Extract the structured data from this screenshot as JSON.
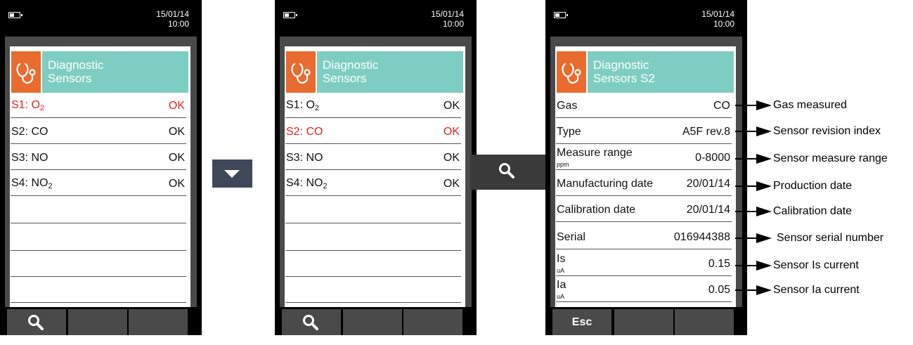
{
  "status": {
    "date": "15/01/14",
    "time": "10:00"
  },
  "screens": [
    {
      "title1": "Diagnostic",
      "title2": "Sensors",
      "rows": [
        {
          "base": "S1: O",
          "sub": "2",
          "value": "OK"
        },
        {
          "base": "S2: CO",
          "sub": "",
          "value": "OK"
        },
        {
          "base": "S3: NO",
          "sub": "",
          "value": "OK"
        },
        {
          "base": "S4: NO",
          "sub": "2",
          "value": "OK"
        }
      ],
      "selected_row": 0
    },
    {
      "title1": "Diagnostic",
      "title2": "Sensors",
      "rows": [
        {
          "base": "S1: O",
          "sub": "2",
          "value": "OK"
        },
        {
          "base": "S2: CO",
          "sub": "",
          "value": "OK"
        },
        {
          "base": "S3: NO",
          "sub": "",
          "value": "OK"
        },
        {
          "base": "S4: NO",
          "sub": "2",
          "value": "OK"
        }
      ],
      "selected_row": 1
    },
    {
      "title1": "Diagnostic",
      "title2": "Sensors S2",
      "rows": [
        {
          "label": "Gas",
          "value": "CO"
        },
        {
          "label": "Type",
          "value": "A5F rev.8"
        },
        {
          "label": "Measure range",
          "unit": "ppm",
          "value": "0-8000"
        },
        {
          "label": "Manufacturing date",
          "value": "20/01/14"
        },
        {
          "label": "Calibration date",
          "value": "20/01/14"
        },
        {
          "label": "Serial",
          "value": "016944388"
        },
        {
          "label": "Is",
          "unit": "uA",
          "value": "0.15"
        },
        {
          "label": "Ia",
          "unit": "uA",
          "value": "0.05"
        }
      ],
      "footer_esc": "Esc"
    }
  ],
  "annotations": [
    "Gas measured",
    "Sensor revision index",
    "Sensor measure range",
    "Production date",
    "Calibration date",
    "Sensor serial number",
    "Sensor Is current",
    "Sensor Ia current"
  ],
  "colors": {
    "selected": "#e82020",
    "header_icon": "#e86b2f",
    "header_title": "#7ecdc3"
  },
  "icons": [
    "battery-icon",
    "stethoscope-icon",
    "search-icon",
    "down-arrow-icon"
  ]
}
